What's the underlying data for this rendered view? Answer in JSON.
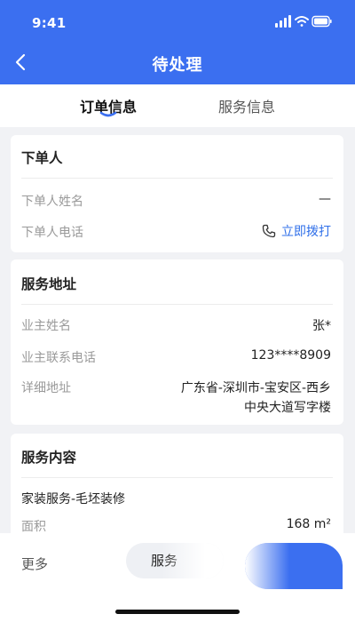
{
  "status_bar": {
    "time": "9:41"
  },
  "nav": {
    "title": "待处理"
  },
  "tabs": [
    {
      "label": "订单信息",
      "active": true
    },
    {
      "label": "服务信息",
      "active": false
    }
  ],
  "orderer": {
    "title": "下单人",
    "name_label": "下单人姓名",
    "name_value": "—",
    "phone_label": "下单人电话",
    "call_label": "立即拨打"
  },
  "address": {
    "title": "服务地址",
    "owner_label": "业主姓名",
    "owner_value": "张*",
    "phone_label": "业主联系电话",
    "phone_value": "123****8909",
    "detail_label": "详细地址",
    "detail_line1": "广东省-深圳市-宝安区-西乡",
    "detail_line2": "中央大道写字楼"
  },
  "content": {
    "title": "服务内容",
    "service_name": "家装服务-毛坯装修",
    "area_label": "面积",
    "area_value": "168 m²"
  },
  "bottom_bar": {
    "more_label": "更多",
    "service_label": "服务"
  },
  "colors": {
    "primary": "#3b6ff0",
    "link": "#2f6fe9"
  }
}
